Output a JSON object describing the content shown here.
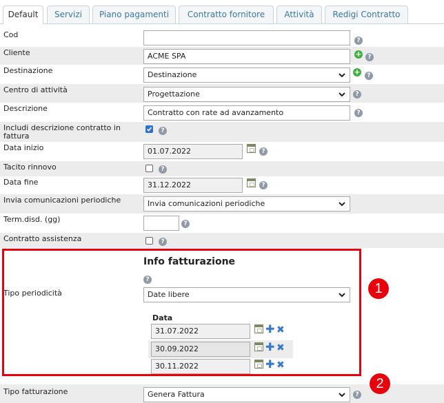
{
  "tabs": [
    {
      "label": "Default",
      "active": true
    },
    {
      "label": "Servizi"
    },
    {
      "label": "Piano pagamenti"
    },
    {
      "label": "Contratto fornitore"
    },
    {
      "label": "Attività"
    },
    {
      "label": "Redigi Contratto"
    }
  ],
  "form": {
    "cod": {
      "label": "Cod",
      "value": ""
    },
    "cliente": {
      "label": "Cliente",
      "value": "ACME SPA"
    },
    "destinazione": {
      "label": "Destinazione",
      "value": "Destinazione"
    },
    "centro_attivita": {
      "label": "Centro di attività",
      "value": "Progettazione"
    },
    "descrizione": {
      "label": "Descrizione",
      "value": "Contratto con rate ad avanzamento"
    },
    "includi_descrizione": {
      "label": "Includi descrizione contratto in fattura",
      "checked": true
    },
    "data_inizio": {
      "label": "Data inizio",
      "value": "01.07.2022"
    },
    "tacito_rinnovo": {
      "label": "Tacito rinnovo",
      "checked": false
    },
    "data_fine": {
      "label": "Data fine",
      "value": "31.12.2022"
    },
    "invia_comunicazioni": {
      "label": "Invia comunicazioni periodiche",
      "value": "Invia comunicazioni periodiche"
    },
    "term_disd": {
      "label": "Term.disd. (gg)",
      "value": ""
    },
    "contratto_assistenza": {
      "label": "Contratto assistenza",
      "checked": false
    },
    "info_fatturazione": {
      "title": "Info fatturazione"
    },
    "tipo_periodicita": {
      "label": "Tipo periodicità",
      "value": "Date libere"
    },
    "date": {
      "header": "Data",
      "values": [
        "31.07.2022",
        "30.09.2022",
        "30.11.2022"
      ]
    },
    "tipo_fatturazione": {
      "label": "Tipo fatturazione",
      "value": "Genera Fattura"
    }
  },
  "icons": {
    "help": "?",
    "plus": "+",
    "add": "✚",
    "remove": "✖"
  },
  "annotations": [
    "1",
    "2"
  ],
  "colors": {
    "accent": "#e8000d",
    "link": "#3a78a8",
    "row_shade": "#ececec"
  }
}
